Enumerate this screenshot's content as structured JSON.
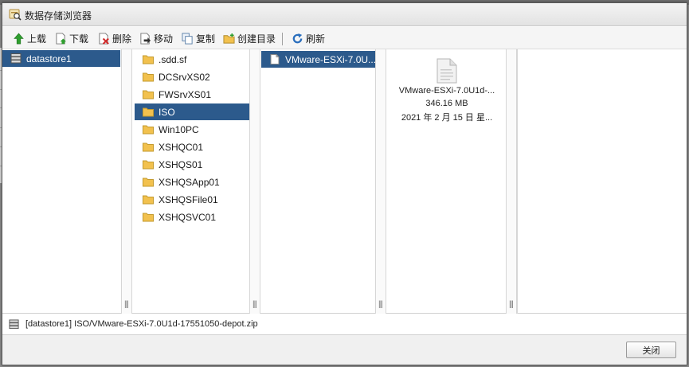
{
  "window": {
    "title": "数据存储浏览器"
  },
  "toolbar": {
    "upload": "上载",
    "download": "下载",
    "delete": "删除",
    "move": "移动",
    "copy": "复制",
    "create_folder": "创建目录",
    "refresh": "刷新"
  },
  "columns": {
    "datastores": [
      "datastore1"
    ],
    "folders": [
      ".sdd.sf",
      "DCSrvXS02",
      "FWSrvXS01",
      "ISO",
      "Win10PC",
      "XSHQC01",
      "XSHQS01",
      "XSHQSApp01",
      "XSHQSFile01",
      "XSHQSVC01"
    ],
    "selected_folder": "ISO",
    "files": [
      "VMware-ESXi-7.0U..."
    ]
  },
  "preview": {
    "name": "VMware-ESXi-7.0U1d-...",
    "size": "346.16 MB",
    "date": "2021 年 2 月 15 日 星..."
  },
  "status": {
    "path": "[datastore1] ISO/VMware-ESXi-7.0U1d-17551050-depot.zip"
  },
  "footer": {
    "close": "关闭"
  },
  "colors": {
    "selection": "#2c5a8c",
    "folder": "#f2c14e",
    "upload_arrow": "#2e9e2e",
    "delete_x": "#d22a2a",
    "refresh": "#2a6ebd"
  },
  "icons": {
    "titlebar": "datastore-browser-icon",
    "datastore": "datastore-icon",
    "folder": "folder-icon",
    "file": "file-icon"
  }
}
